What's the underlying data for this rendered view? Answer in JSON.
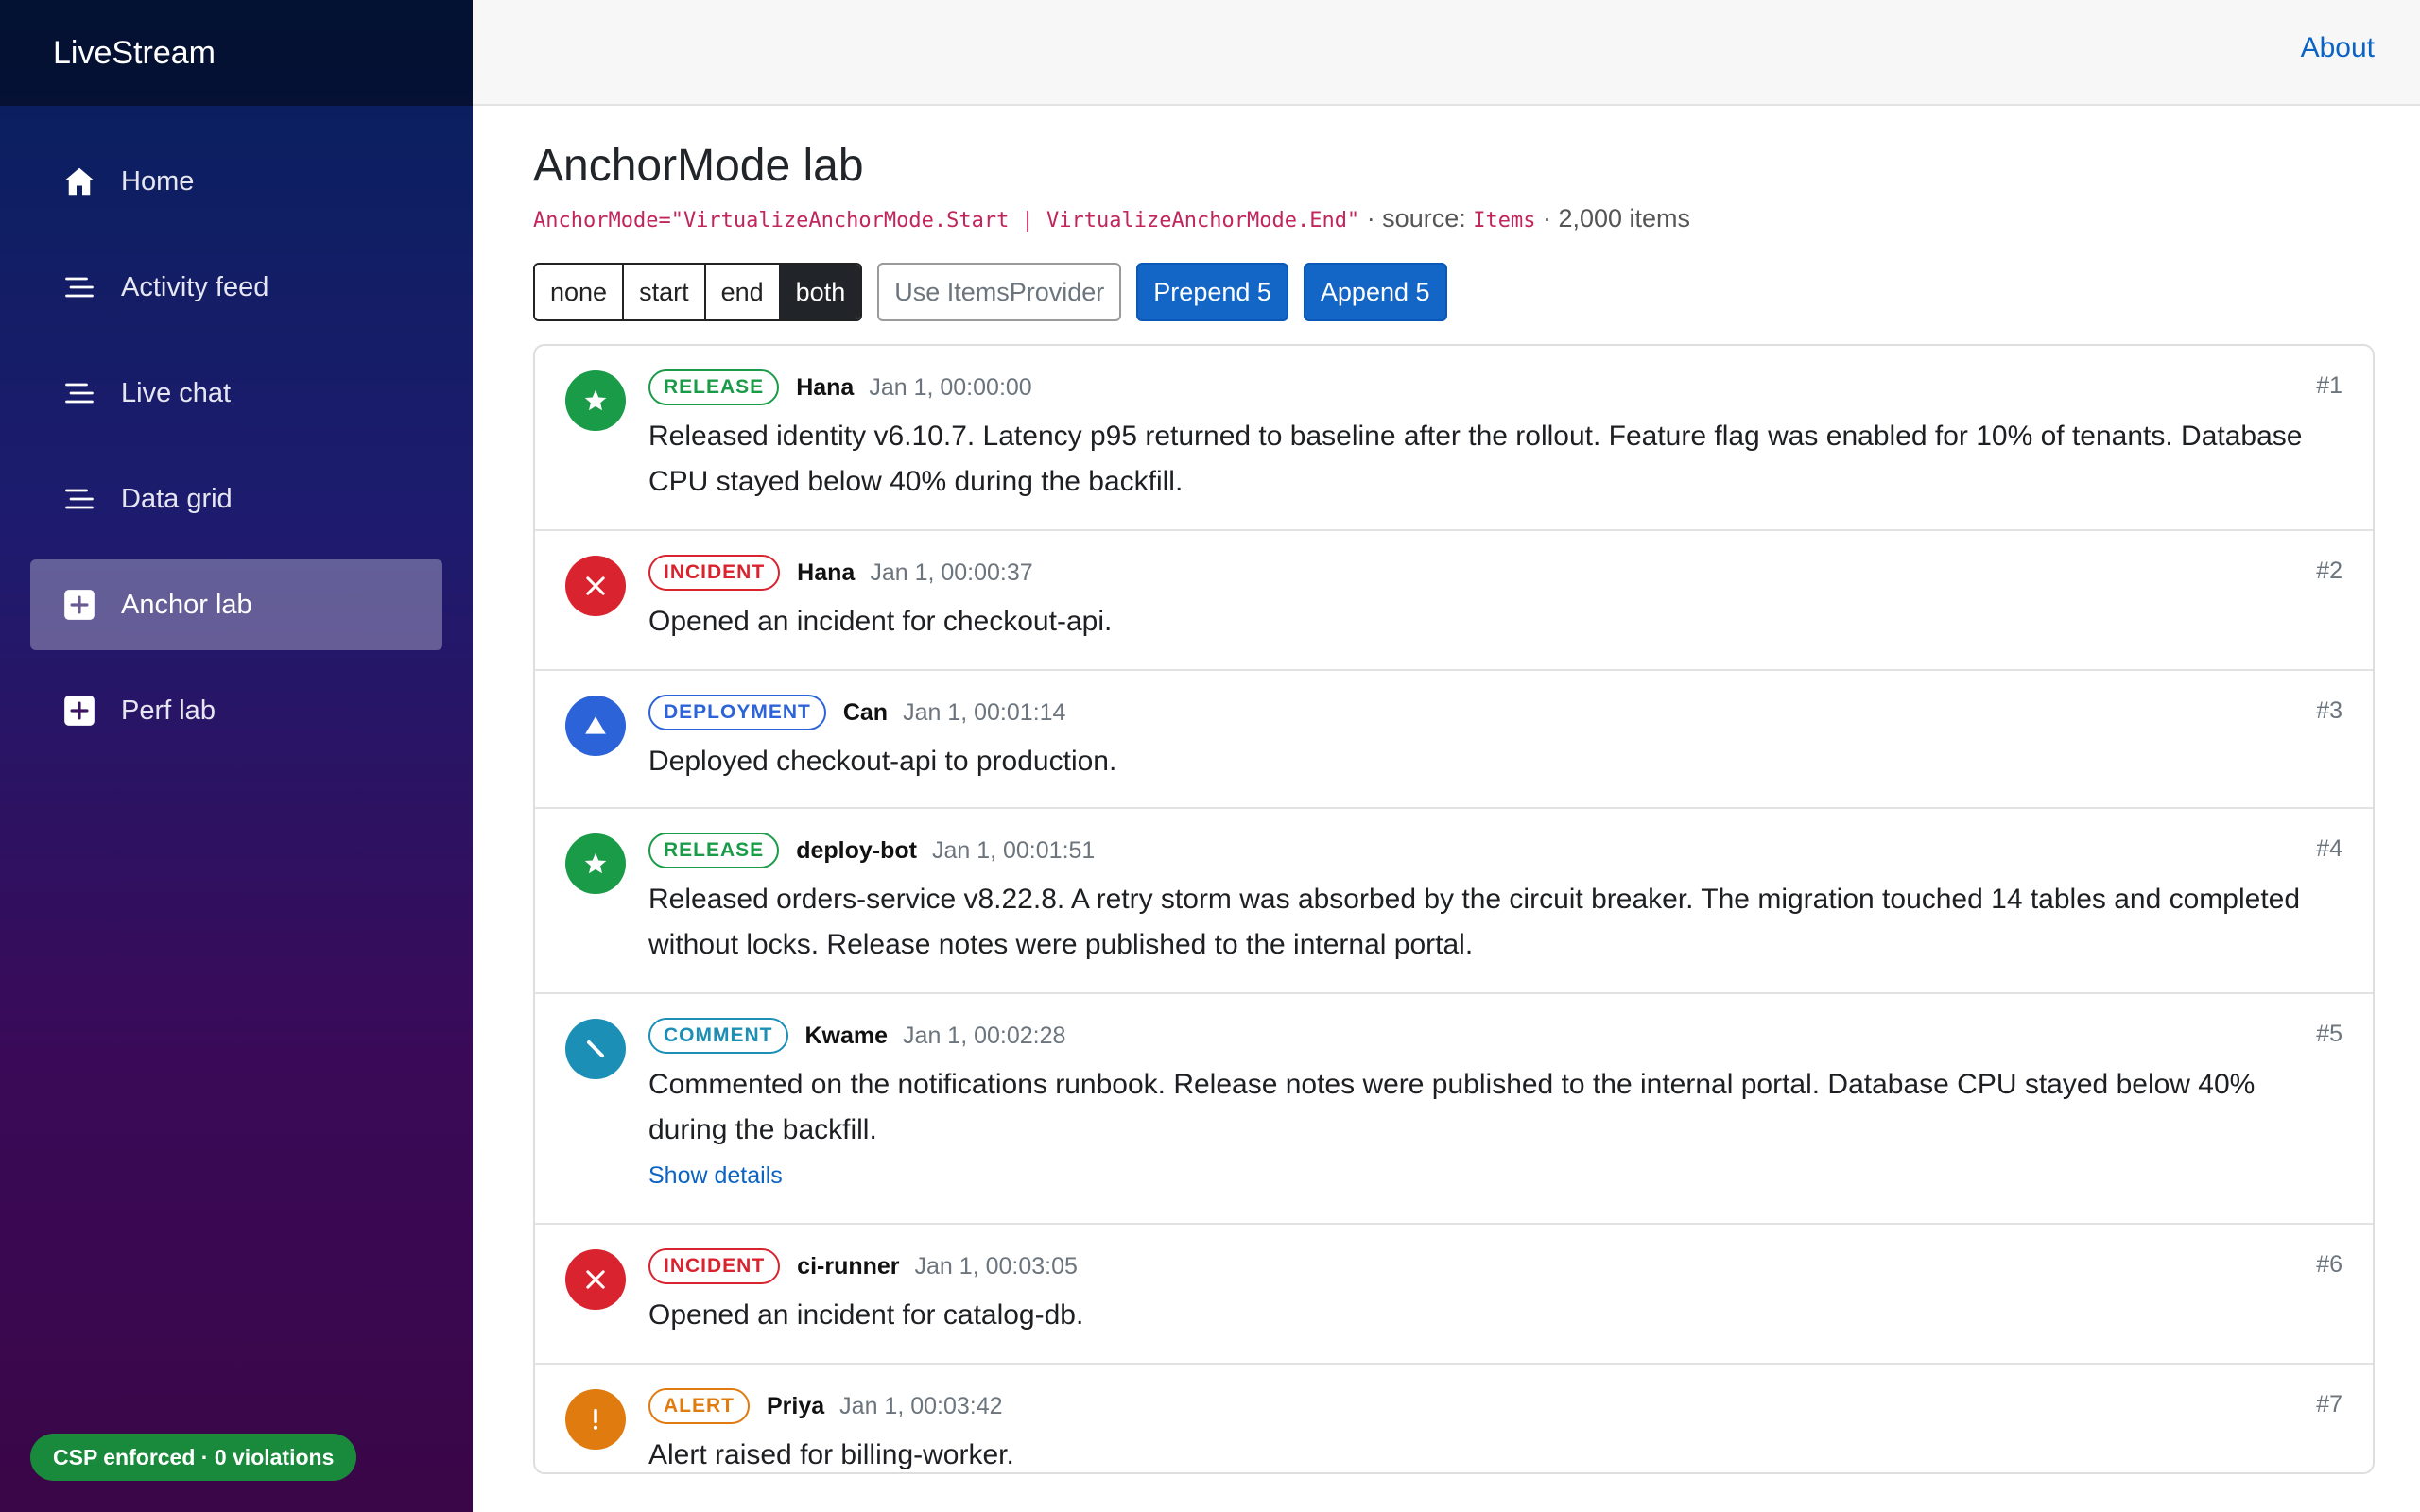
{
  "brand": "LiveStream",
  "sidebar": {
    "items": [
      {
        "label": "Home",
        "icon": "home-icon"
      },
      {
        "label": "Activity feed",
        "icon": "list-icon"
      },
      {
        "label": "Live chat",
        "icon": "list-icon"
      },
      {
        "label": "Data grid",
        "icon": "list-icon"
      },
      {
        "label": "Anchor lab",
        "icon": "plus-square-icon",
        "active": true
      },
      {
        "label": "Perf lab",
        "icon": "plus-square-icon"
      }
    ],
    "csp_badge": "CSP enforced · 0 violations"
  },
  "topbar": {
    "about": "About"
  },
  "page": {
    "title": "AnchorMode lab",
    "anchor_code": "AnchorMode=\"VirtualizeAnchorMode.Start | VirtualizeAnchorMode.End\"",
    "sep1": " · source: ",
    "source_code": "Items",
    "sep2": " · 2,000 items"
  },
  "controls": {
    "modes": [
      "none",
      "start",
      "end",
      "both"
    ],
    "selected_mode": "both",
    "use_provider": "Use ItemsProvider",
    "prepend": "Prepend 5",
    "append": "Append 5"
  },
  "colors": {
    "release": "#1a9b48",
    "incident": "#d9232e",
    "deployment": "#2c63d8",
    "comment": "#1b8fb5",
    "alert": "#e07b10"
  },
  "feed": [
    {
      "kind": "release",
      "tag": "RELEASE",
      "author": "Hana",
      "time": "Jan 1, 00:00:00",
      "num": "#1",
      "icon": "star-icon",
      "text": "Released identity v6.10.7. Latency p95 returned to baseline after the rollout. Feature flag was enabled for 10% of tenants. Database CPU stayed below 40% during the backfill."
    },
    {
      "kind": "incident",
      "tag": "INCIDENT",
      "author": "Hana",
      "time": "Jan 1, 00:00:37",
      "num": "#2",
      "icon": "x-icon",
      "text": "Opened an incident for checkout-api."
    },
    {
      "kind": "deployment",
      "tag": "DEPLOYMENT",
      "author": "Can",
      "time": "Jan 1, 00:01:14",
      "num": "#3",
      "icon": "triangle-icon",
      "text": "Deployed checkout-api to production."
    },
    {
      "kind": "release",
      "tag": "RELEASE",
      "author": "deploy-bot",
      "time": "Jan 1, 00:01:51",
      "num": "#4",
      "icon": "star-icon",
      "text": "Released orders-service v8.22.8. A retry storm was absorbed by the circuit breaker. The migration touched 14 tables and completed without locks. Release notes were published to the internal portal."
    },
    {
      "kind": "comment",
      "tag": "COMMENT",
      "author": "Kwame",
      "time": "Jan 1, 00:02:28",
      "num": "#5",
      "icon": "pencil-icon",
      "text": "Commented on the notifications runbook. Release notes were published to the internal portal. Database CPU stayed below 40% during the backfill.",
      "details": "Show details"
    },
    {
      "kind": "incident",
      "tag": "INCIDENT",
      "author": "ci-runner",
      "time": "Jan 1, 00:03:05",
      "num": "#6",
      "icon": "x-icon",
      "text": "Opened an incident for catalog-db."
    },
    {
      "kind": "alert",
      "tag": "ALERT",
      "author": "Priya",
      "time": "Jan 1, 00:03:42",
      "num": "#7",
      "icon": "exclamation-icon",
      "text": "Alert raised for billing-worker."
    }
  ]
}
